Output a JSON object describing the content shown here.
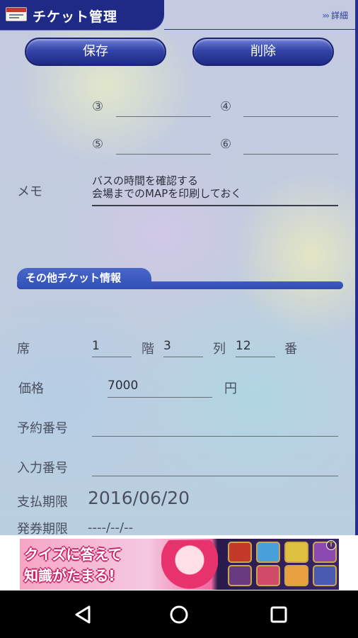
{
  "header": {
    "title": "チケット管理",
    "detail_link": "詳細",
    "detail_chevrons": "»›"
  },
  "toolbar": {
    "save_label": "保存",
    "delete_label": "削除"
  },
  "performers": [
    {
      "num": "③",
      "value": ""
    },
    {
      "num": "④",
      "value": ""
    },
    {
      "num": "⑤",
      "value": ""
    },
    {
      "num": "⑥",
      "value": ""
    }
  ],
  "memo": {
    "label": "メモ",
    "line1": "バスの時間を確認する",
    "line2": "会場までのMAPを印刷しておく"
  },
  "other_section": {
    "title": "その他チケット情報"
  },
  "seat": {
    "label": "席",
    "floor_value": "1",
    "floor_unit": "階",
    "row_value": "3",
    "row_unit": "列",
    "number_value": "12",
    "number_unit": "番"
  },
  "price": {
    "label": "価格",
    "value": "7000",
    "unit": "円"
  },
  "reservation": {
    "label": "予約番号",
    "value": ""
  },
  "entry": {
    "label": "入力番号",
    "value": ""
  },
  "payment_deadline": {
    "label": "支払期限",
    "value": "2016/06/20"
  },
  "issue_deadline": {
    "label": "発券期限",
    "value": "----/--/--"
  },
  "ad": {
    "line1": "クイズに答えて",
    "line2": "知識がたまる!",
    "info_glyph": "i"
  },
  "colors": {
    "header_bg": "#1f2a86",
    "button_blue": "#3344a8",
    "section_blue": "#3f5bc2"
  }
}
